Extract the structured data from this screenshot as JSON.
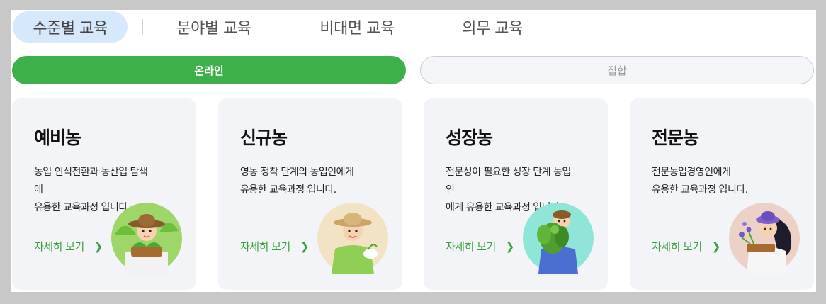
{
  "tabs": [
    {
      "label": "수준별 교육",
      "active": true
    },
    {
      "label": "분야별 교육",
      "active": false
    },
    {
      "label": "비대면 교육",
      "active": false
    },
    {
      "label": "의무 교육",
      "active": false
    }
  ],
  "mode": {
    "online_label": "온라인",
    "group_label": "집합"
  },
  "cards": [
    {
      "title": "예비농",
      "desc_lines": [
        "농업 인식전환과 농산업 탐색",
        "에",
        "유용한 교육과정 입니다."
      ],
      "more_label": "자세히 보기",
      "illustration": "farmer-with-basket"
    },
    {
      "title": "신규농",
      "desc_lines": [
        "영농 정착 단계의 농업인에게",
        "유용한 교육과정 입니다."
      ],
      "more_label": "자세히 보기",
      "illustration": "farmer-with-hat"
    },
    {
      "title": "성장농",
      "desc_lines": [
        "전문성이 필요한 성장 단계 농업",
        "인",
        "에게 유용한 교육과정 입니다."
      ],
      "more_label": "자세히 보기",
      "illustration": "farmer-with-greens"
    },
    {
      "title": "전문농",
      "desc_lines": [
        "전문농업경영인에게",
        "유용한 교육과정 입니다."
      ],
      "more_label": "자세히 보기",
      "illustration": "farmer-with-flowers"
    }
  ],
  "colors": {
    "accent_green": "#3db04b",
    "active_tab_bg": "#d6e8fb",
    "card_bg": "#f3f4f8"
  }
}
